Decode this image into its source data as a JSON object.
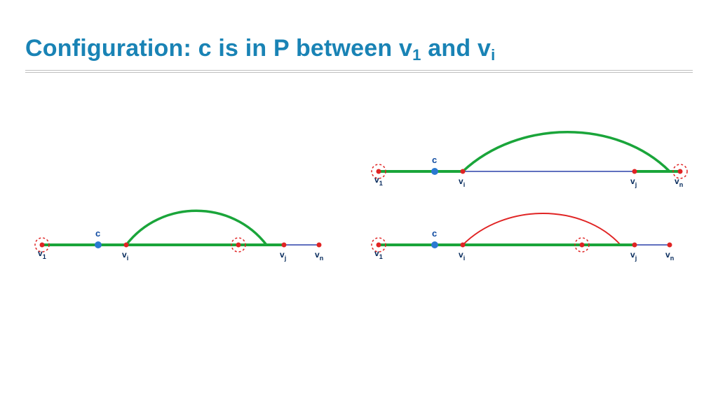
{
  "title": {
    "prefix": "Configuration: c is in P between v",
    "sub1": "1",
    "mid": " and v",
    "sub2": "i"
  },
  "colors": {
    "accent_title": "#1983b5",
    "path_green": "#1aa53a",
    "path_red": "#e02424",
    "line_navy": "#001a99",
    "dot_red": "#e02424",
    "dot_blue": "#2a79d1",
    "dashed_red": "#e02424",
    "label_navy": "#062a5c"
  },
  "labels": {
    "v1": "v",
    "v1_sub": "1",
    "vi": "v",
    "vi_sub": "i",
    "vj": "v",
    "vj_sub": "j",
    "vn": "v",
    "vn_sub": "n",
    "c": "c"
  },
  "chart_data": [
    {
      "id": "left",
      "nodes": [
        "v1",
        "c",
        "vi",
        "*",
        "vj",
        "vn"
      ],
      "c_between": [
        "v1",
        "vi"
      ],
      "green_segment": [
        "v1",
        "vj"
      ],
      "navy_segment": [
        "vj",
        "vn"
      ],
      "arc": {
        "from": "vi",
        "to": "vj-left",
        "color_key": "path_green"
      },
      "dashed_circles_at": [
        "v1",
        "*"
      ],
      "note": "* is an unlabeled intermediate point between vi and vj"
    },
    {
      "id": "top_right",
      "nodes": [
        "v1",
        "c",
        "vi",
        "vj",
        "vn"
      ],
      "c_between": [
        "v1",
        "vi"
      ],
      "green_segment": [
        "v1",
        "vn"
      ],
      "navy_segment": [
        "vi",
        "vj"
      ],
      "arc": {
        "from": "vi",
        "to": "vn-left",
        "color_key": "path_green"
      },
      "dashed_circles_at": [
        "v1",
        "vn"
      ]
    },
    {
      "id": "bottom_right",
      "nodes": [
        "v1",
        "c",
        "vi",
        "*",
        "vj",
        "vn"
      ],
      "c_between": [
        "v1",
        "vi"
      ],
      "green_segment": [
        "v1",
        "vj"
      ],
      "navy_segment": [
        "vj",
        "vn"
      ],
      "arc": {
        "from": "vi",
        "to": "vj-left",
        "color_key": "path_red"
      },
      "dashed_circles_at": [
        "v1",
        "*"
      ],
      "note": "* is an unlabeled intermediate point between vi and vj"
    }
  ]
}
